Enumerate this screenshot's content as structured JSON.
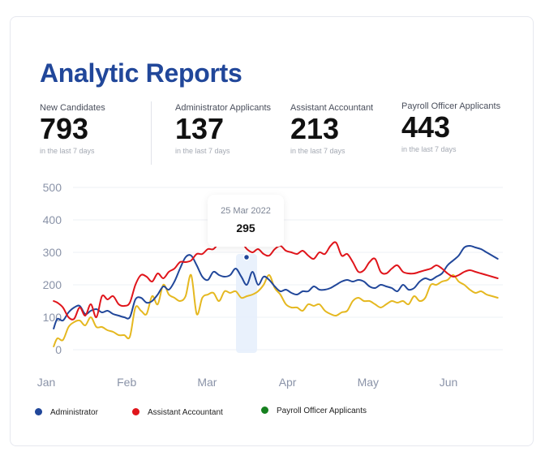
{
  "title": "Analytic Reports",
  "stats": [
    {
      "label": "New Candidates",
      "value": "793",
      "sub": "in the last 7 days"
    },
    {
      "label": "Administrator Applicants",
      "value": "137",
      "sub": "in the last 7 days"
    },
    {
      "label": "Assistant Accountant",
      "value": "213",
      "sub": "in the last 7 days"
    },
    {
      "label": "Payroll Officer Applicants",
      "value": "443",
      "sub": "in the last 7 days"
    }
  ],
  "tooltip": {
    "date": "25 Mar 2022",
    "value": "295"
  },
  "legend": [
    {
      "label": "Administrator",
      "color": "#21479a"
    },
    {
      "label": "Assistant Accountant",
      "color": "#e0151b"
    },
    {
      "label": "Payroll Officer Applicants",
      "color": "#16801f"
    }
  ],
  "chart_data": {
    "type": "line",
    "x_ticks": [
      "Jan",
      "Feb",
      "Mar",
      "Apr",
      "May",
      "Jun"
    ],
    "y_ticks": [
      0,
      100,
      200,
      300,
      400,
      500
    ],
    "ylim": [
      0,
      500
    ],
    "x_unit": "weeks from Jan",
    "series": [
      {
        "name": "Administrator",
        "color": "#21479a",
        "x": [
          0.4,
          0.6,
          0.9,
          1.2,
          1.5,
          1.8,
          2.1,
          2.4,
          2.7,
          3.0,
          3.3,
          3.6,
          3.9,
          4.2,
          4.5,
          4.8,
          5.1,
          5.4,
          5.7,
          6.0,
          6.3,
          6.6,
          6.9,
          7.2,
          7.5,
          7.8,
          8.1,
          8.4,
          8.7,
          9.0,
          9.3,
          9.6,
          9.9,
          10.2,
          10.5,
          10.8,
          11.1,
          11.4,
          11.7,
          12.0,
          12.3,
          12.6,
          12.9,
          13.2,
          13.5,
          13.8,
          14.1,
          14.4,
          14.7,
          15.0,
          15.3,
          15.6,
          15.9,
          16.2,
          16.5,
          16.8,
          17.1,
          17.4,
          17.7,
          18.0,
          18.3,
          18.6,
          18.9,
          19.2,
          19.5,
          19.8,
          20.1,
          20.4,
          20.7,
          21.0,
          21.3,
          21.6,
          21.9,
          22.2,
          22.5,
          22.8,
          23.1,
          23.4,
          23.7,
          24.0,
          24.3
        ],
        "values": [
          65,
          95,
          90,
          115,
          130,
          135,
          110,
          120,
          125,
          115,
          120,
          110,
          105,
          100,
          100,
          155,
          160,
          145,
          150,
          170,
          195,
          185,
          210,
          250,
          285,
          290,
          260,
          225,
          215,
          240,
          230,
          225,
          230,
          250,
          225,
          200,
          240,
          200,
          225,
          215,
          195,
          180,
          185,
          175,
          170,
          180,
          180,
          195,
          185,
          185,
          190,
          200,
          210,
          215,
          210,
          215,
          210,
          195,
          190,
          200,
          195,
          190,
          180,
          200,
          185,
          190,
          210,
          220,
          215,
          225,
          235,
          260,
          275,
          290,
          315,
          320,
          315,
          310,
          300,
          290,
          280
        ]
      },
      {
        "name": "Assistant Accountant",
        "color": "#e0151b",
        "x": [
          0.4,
          0.6,
          0.9,
          1.2,
          1.5,
          1.8,
          2.1,
          2.4,
          2.7,
          3.0,
          3.3,
          3.6,
          3.9,
          4.2,
          4.5,
          4.8,
          5.1,
          5.4,
          5.7,
          6.0,
          6.3,
          6.6,
          6.9,
          7.2,
          7.5,
          7.8,
          8.1,
          8.4,
          8.7,
          9.0,
          9.3,
          9.6,
          9.9,
          10.2,
          10.5,
          10.8,
          11.1,
          11.4,
          11.7,
          12.0,
          12.3,
          12.6,
          12.9,
          13.2,
          13.5,
          13.8,
          14.1,
          14.4,
          14.7,
          15.0,
          15.3,
          15.6,
          15.9,
          16.2,
          16.5,
          16.8,
          17.1,
          17.4,
          17.7,
          18.0,
          18.3,
          18.6,
          18.9,
          19.2,
          19.5,
          19.8,
          20.1,
          20.4,
          20.7,
          21.0,
          21.3,
          21.6,
          21.9,
          22.2,
          22.5,
          22.8,
          23.1,
          23.4,
          23.7,
          24.0,
          24.3
        ],
        "values": [
          150,
          145,
          130,
          100,
          95,
          130,
          105,
          140,
          100,
          165,
          155,
          165,
          140,
          135,
          145,
          200,
          230,
          225,
          210,
          235,
          220,
          240,
          250,
          270,
          270,
          275,
          295,
          295,
          310,
          310,
          330,
          350,
          340,
          320,
          330,
          310,
          300,
          310,
          295,
          290,
          310,
          320,
          305,
          300,
          295,
          305,
          290,
          280,
          300,
          295,
          320,
          330,
          290,
          295,
          270,
          240,
          245,
          270,
          280,
          240,
          235,
          250,
          260,
          240,
          235,
          235,
          240,
          245,
          250,
          260,
          250,
          235,
          225,
          230,
          240,
          245,
          240,
          235,
          230,
          225,
          220
        ]
      },
      {
        "name": "Payroll Officer Applicants",
        "color": "#e5b820",
        "x": [
          0.4,
          0.6,
          0.9,
          1.2,
          1.5,
          1.8,
          2.1,
          2.4,
          2.7,
          3.0,
          3.3,
          3.6,
          3.9,
          4.2,
          4.5,
          4.8,
          5.1,
          5.4,
          5.7,
          6.0,
          6.3,
          6.6,
          6.9,
          7.2,
          7.5,
          7.8,
          8.1,
          8.4,
          8.7,
          9.0,
          9.3,
          9.6,
          9.9,
          10.2,
          10.5,
          10.8,
          11.1,
          11.4,
          11.7,
          12.0,
          12.3,
          12.6,
          12.9,
          13.2,
          13.5,
          13.8,
          14.1,
          14.4,
          14.7,
          15.0,
          15.3,
          15.6,
          15.9,
          16.2,
          16.5,
          16.8,
          17.1,
          17.4,
          17.7,
          18.0,
          18.3,
          18.6,
          18.9,
          19.2,
          19.5,
          19.8,
          20.1,
          20.4,
          20.7,
          21.0,
          21.3,
          21.6,
          21.9,
          22.2,
          22.5,
          22.8,
          23.1,
          23.4,
          23.7,
          24.0,
          24.3
        ],
        "values": [
          10,
          35,
          30,
          70,
          85,
          90,
          75,
          100,
          70,
          70,
          60,
          55,
          45,
          45,
          40,
          130,
          120,
          110,
          165,
          140,
          200,
          170,
          160,
          150,
          165,
          230,
          110,
          160,
          170,
          175,
          150,
          180,
          175,
          180,
          160,
          165,
          170,
          180,
          200,
          230,
          190,
          170,
          140,
          130,
          130,
          120,
          140,
          135,
          140,
          120,
          110,
          105,
          115,
          120,
          150,
          160,
          150,
          150,
          140,
          130,
          140,
          150,
          145,
          150,
          140,
          165,
          150,
          160,
          200,
          200,
          210,
          215,
          230,
          210,
          200,
          185,
          175,
          180,
          170,
          165,
          160
        ]
      }
    ]
  }
}
